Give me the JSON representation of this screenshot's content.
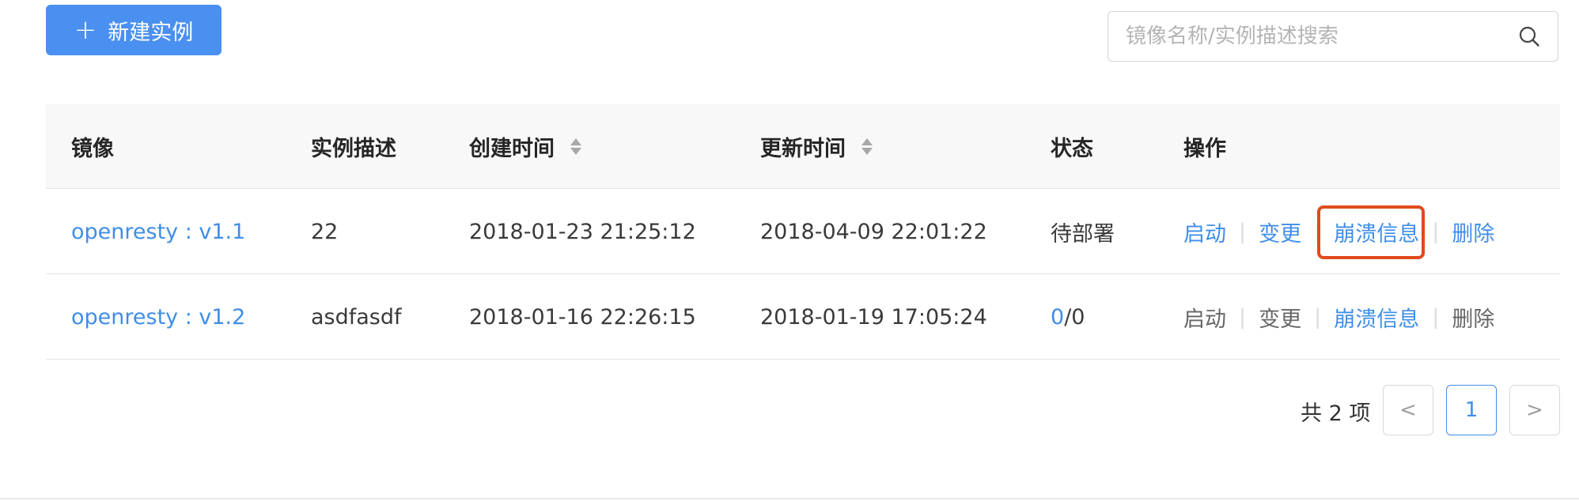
{
  "toolbar": {
    "new_instance_label": "新建实例",
    "plus_symbol": "+"
  },
  "search": {
    "placeholder": "镜像名称/实例描述搜索",
    "value": ""
  },
  "table": {
    "headers": {
      "image": "镜像",
      "description": "实例描述",
      "created": "创建时间",
      "updated": "更新时间",
      "status": "状态",
      "actions": "操作"
    },
    "rows": [
      {
        "image": "openresty : v1.1",
        "description": "22",
        "created": "2018-01-23 21:25:12",
        "updated": "2018-04-09 22:01:22",
        "status": "待部署",
        "actions": {
          "start": "启动",
          "change": "变更",
          "crash": "崩溃信息",
          "delete": "删除"
        }
      },
      {
        "image": "openresty : v1.2",
        "description": "asdfasdf",
        "created": "2018-01-16 22:26:15",
        "updated": "2018-01-19 17:05:24",
        "status_running": "0",
        "status_total": "/0",
        "actions": {
          "start": "启动",
          "change": "变更",
          "crash": "崩溃信息",
          "delete": "删除"
        }
      }
    ]
  },
  "pagination": {
    "total_text": "共 2 项",
    "current_page": "1",
    "prev_symbol": "<",
    "next_symbol": ">"
  },
  "colors": {
    "primary": "#4a90f0",
    "link": "#3f8ee8",
    "highlight_border": "#e04a1d"
  }
}
